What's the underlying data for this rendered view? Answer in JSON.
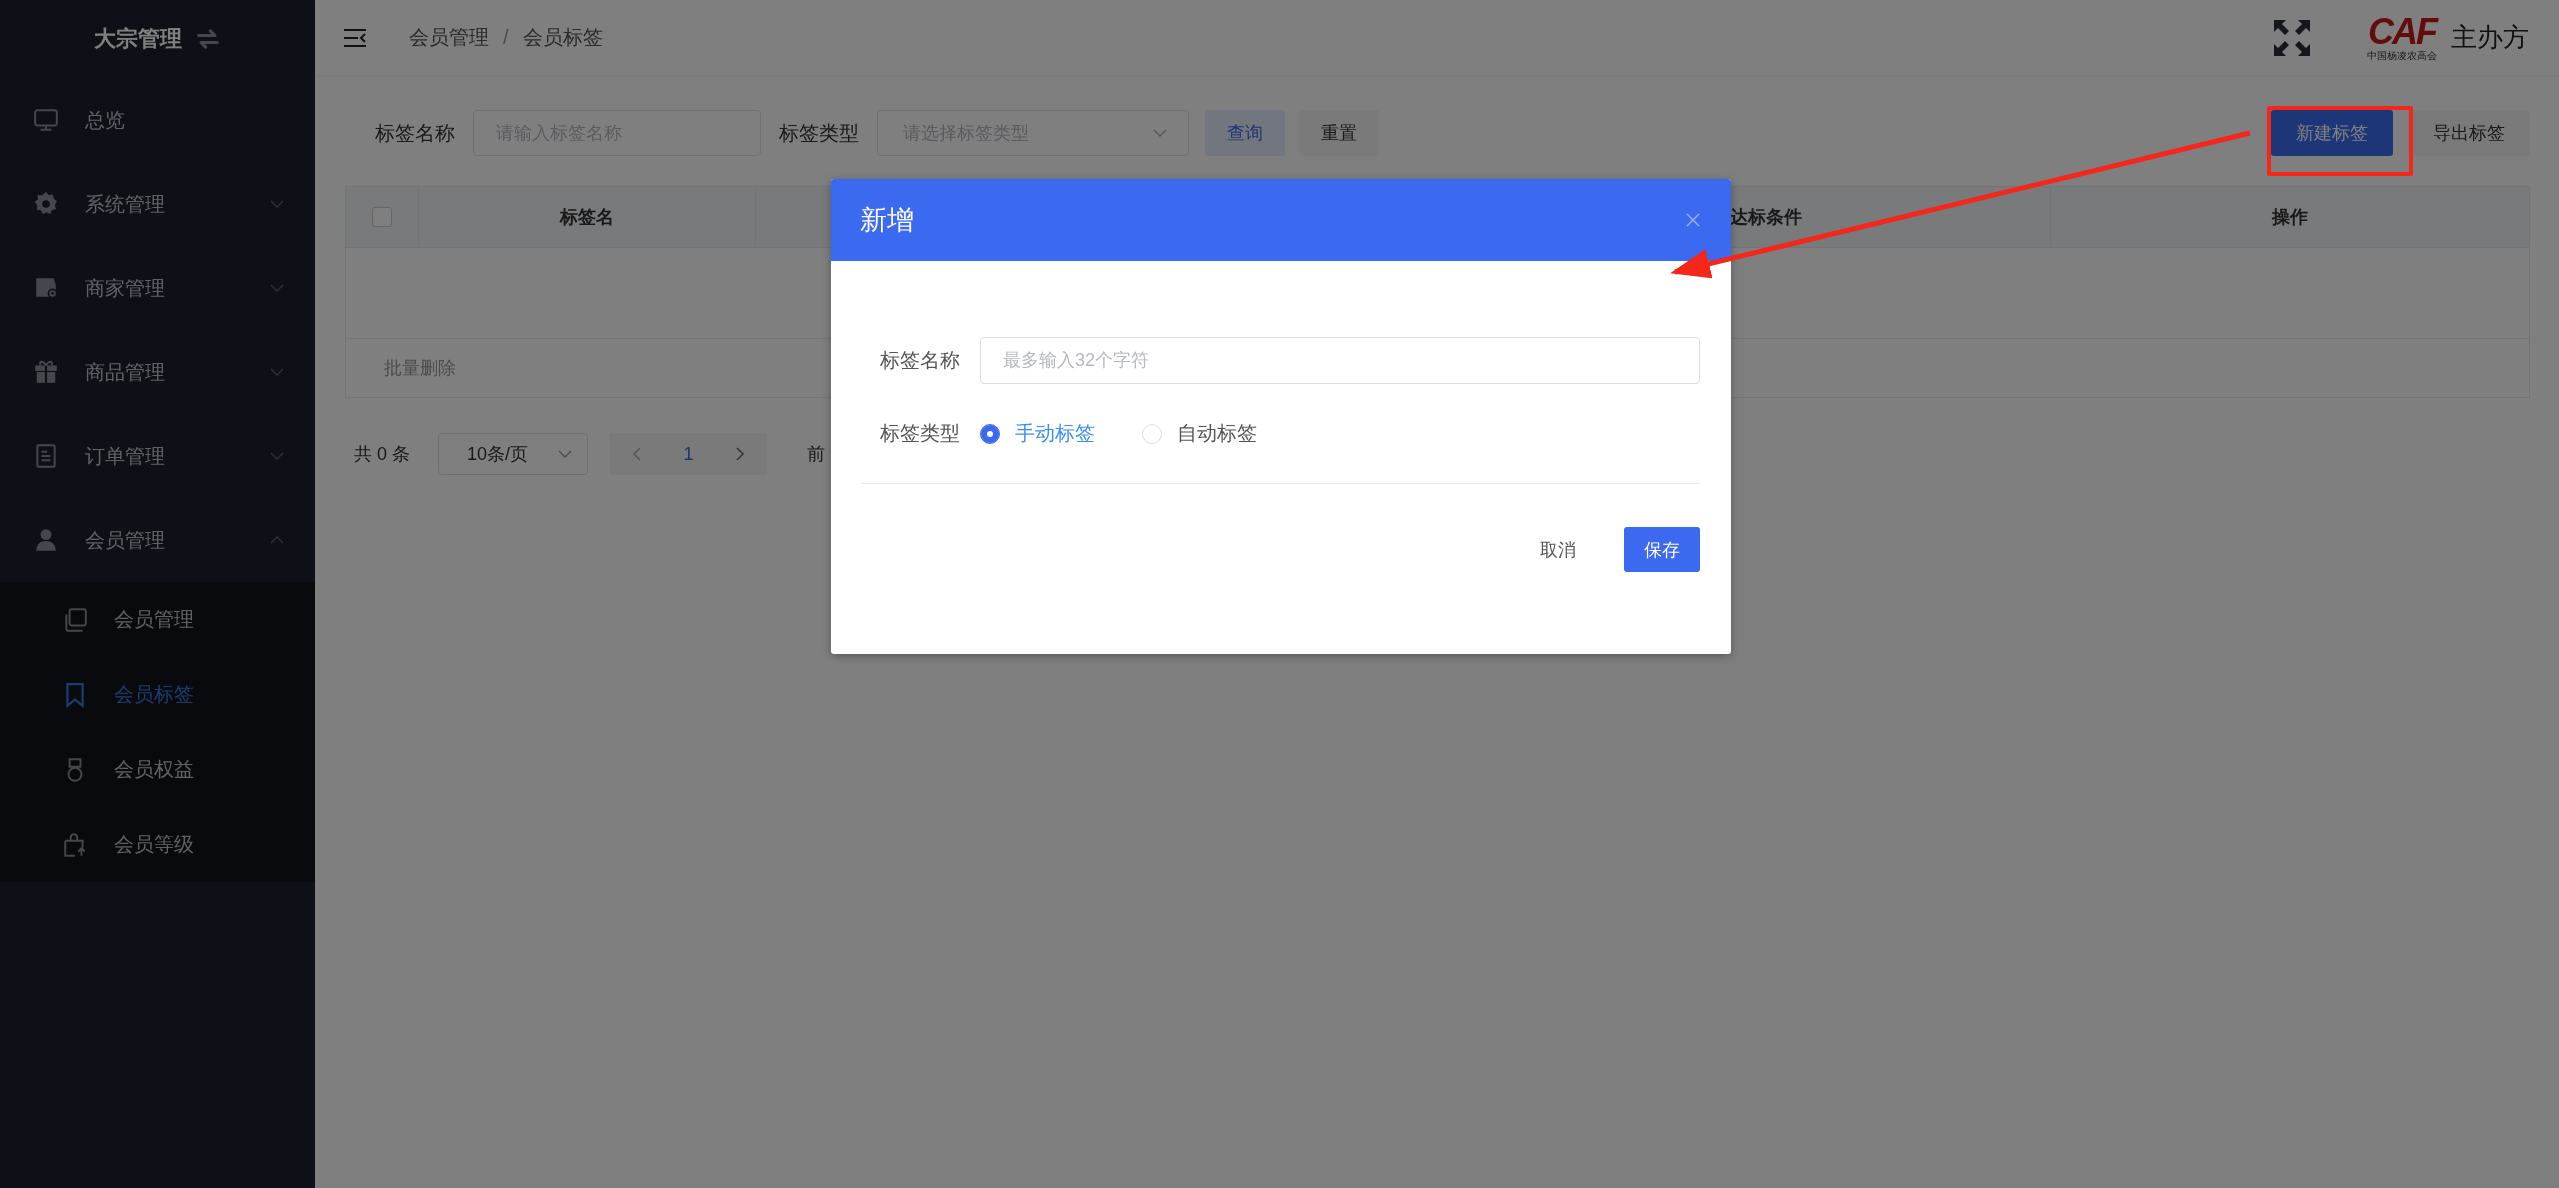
{
  "sidebar": {
    "title": "大宗管理",
    "menu": [
      {
        "label": "总览",
        "kind": "link"
      },
      {
        "label": "系统管理",
        "kind": "group",
        "expanded": false
      },
      {
        "label": "商家管理",
        "kind": "group",
        "expanded": false
      },
      {
        "label": "商品管理",
        "kind": "group",
        "expanded": false
      },
      {
        "label": "订单管理",
        "kind": "group",
        "expanded": false
      },
      {
        "label": "会员管理",
        "kind": "group",
        "expanded": true,
        "children": [
          {
            "label": "会员管理",
            "selected": false
          },
          {
            "label": "会员标签",
            "selected": true
          },
          {
            "label": "会员权益",
            "selected": false
          },
          {
            "label": "会员等级",
            "selected": false
          }
        ]
      }
    ]
  },
  "header": {
    "breadcrumb": [
      "会员管理",
      "会员标签"
    ],
    "separator": "/",
    "logo": {
      "mark": "CAF",
      "subtitle": "中国杨凌农高会"
    },
    "organizer": "主办方"
  },
  "filters": [
    {
      "label": "标签名称",
      "kind": "input",
      "placeholder": "请输入标签名称"
    },
    {
      "label": "标签类型",
      "kind": "select",
      "placeholder": "请选择标签类型"
    }
  ],
  "filter_buttons": [
    {
      "label": "查询",
      "kind": "plain-primary"
    },
    {
      "label": "重置",
      "kind": "default"
    }
  ],
  "actions": [
    {
      "label": "新建标签",
      "kind": "primary"
    },
    {
      "label": "导出标签",
      "kind": "default"
    }
  ],
  "table": {
    "select_all": {
      "checked": false
    },
    "columns": [
      "标签名",
      "达标条件",
      "操作"
    ],
    "footer_action": "批量删除"
  },
  "pagination": {
    "total": "共 0 条",
    "page_size": "10条/页",
    "current_page": "1",
    "goto": "前"
  },
  "dialog": {
    "title": "新增",
    "fields": [
      {
        "label": "标签名称",
        "kind": "input",
        "placeholder": "最多输入32个字符"
      },
      {
        "label": "标签类型",
        "kind": "radio",
        "options": [
          {
            "label": "手动标签",
            "selected": true
          },
          {
            "label": "自动标签",
            "selected": false
          }
        ]
      }
    ],
    "buttons": [
      {
        "label": "取消",
        "kind": "text"
      },
      {
        "label": "保存",
        "kind": "primary"
      }
    ]
  }
}
